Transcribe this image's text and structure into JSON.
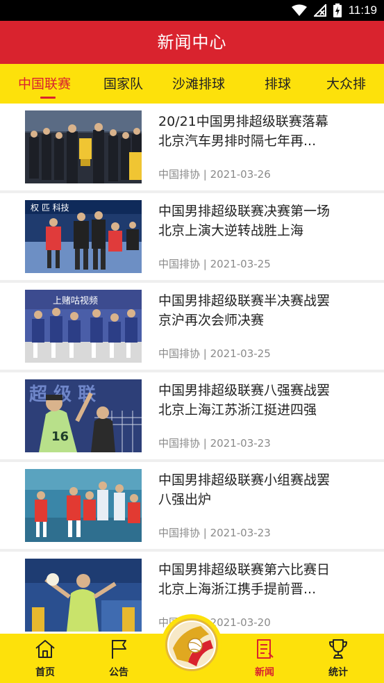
{
  "status_bar": {
    "time": "11:19"
  },
  "app_bar": {
    "title": "新闻中心"
  },
  "tabs": [
    {
      "label": "中国联赛",
      "active": true
    },
    {
      "label": "国家队",
      "active": false
    },
    {
      "label": "沙滩排球",
      "active": false
    },
    {
      "label": "排球",
      "active": false
    },
    {
      "label": "大众排",
      "active": false
    }
  ],
  "news": [
    {
      "line1": "20/21中国男排超级联赛落幕",
      "line2": "北京汽车男排时隔七年再...",
      "source": "中国排协",
      "date": "2021-03-26",
      "meta": "中国排协 | 2021-03-26"
    },
    {
      "line1": "中国男排超级联赛决赛第一场",
      "line2": "北京上演大逆转战胜上海",
      "source": "中国排协",
      "date": "2021-03-25",
      "meta": "中国排协 | 2021-03-25"
    },
    {
      "line1": "中国男排超级联赛半决赛战罢",
      "line2": "京沪再次会师决赛",
      "source": "中国排协",
      "date": "2021-03-25",
      "meta": "中国排协 | 2021-03-25"
    },
    {
      "line1": "中国男排超级联赛八强赛战罢",
      "line2": "北京上海江苏浙江挺进四强",
      "source": "中国排协",
      "date": "2021-03-23",
      "meta": "中国排协 | 2021-03-23"
    },
    {
      "line1": "中国男排超级联赛小组赛战罢",
      "line2": "八强出炉",
      "source": "中国排协",
      "date": "2021-03-23",
      "meta": "中国排协 | 2021-03-23"
    },
    {
      "line1": "中国男排超级联赛第六比赛日",
      "line2": "北京上海浙江携手提前晋...",
      "source": "中国排协",
      "date": "2021-03-20",
      "meta": "中国排协 | 2021-03-20"
    }
  ],
  "thumb_text": {
    "banner2": "权 匹 科技",
    "banner3": "上赌咕视频",
    "banner4": "超 级 联",
    "jersey4": "16"
  },
  "bottom_nav": [
    {
      "label": "首页",
      "icon": "home-icon",
      "active": false
    },
    {
      "label": "公告",
      "icon": "flag-icon",
      "active": false
    },
    {
      "label": "新闻",
      "icon": "news-icon",
      "active": true
    },
    {
      "label": "统计",
      "icon": "trophy-icon",
      "active": false
    }
  ],
  "colors": {
    "primary_red": "#d9232e",
    "tab_yellow": "#fde10b",
    "text_dark": "#222222",
    "text_gray": "#8a8a8a"
  }
}
